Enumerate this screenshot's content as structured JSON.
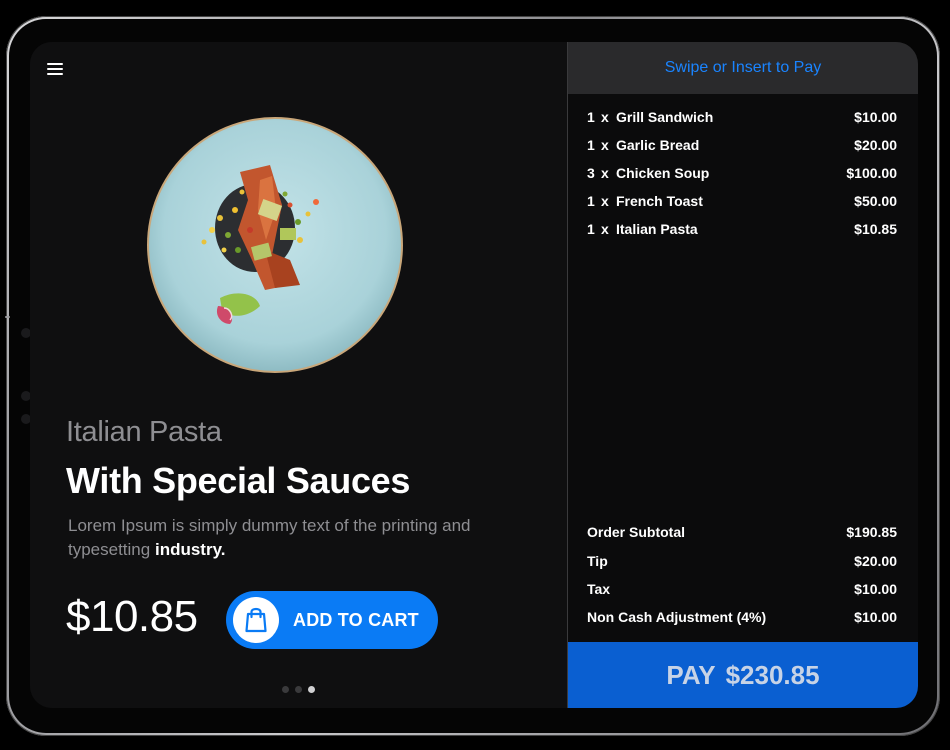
{
  "product": {
    "name": "Italian Pasta",
    "tagline": "With Special Sauces",
    "description": "Lorem Ipsum is simply dummy text of the printing and typesetting",
    "description_emphasis": "industry.",
    "price": "$10.85",
    "add_to_cart_label": "ADD TO CART",
    "image": "plated-dish-image",
    "carousel": {
      "count": 3,
      "active_index": 2
    }
  },
  "order_panel": {
    "header": "Swipe or Insert to Pay",
    "items": [
      {
        "qty": "1",
        "x": "x",
        "name": "Grill Sandwich",
        "amount": "$10.00"
      },
      {
        "qty": "1",
        "x": "x",
        "name": "Garlic Bread",
        "amount": "$20.00"
      },
      {
        "qty": "3",
        "x": "x",
        "name": "Chicken Soup",
        "amount": "$100.00"
      },
      {
        "qty": "1",
        "x": "x",
        "name": "French Toast",
        "amount": "$50.00"
      },
      {
        "qty": "1",
        "x": "x",
        "name": "Italian Pasta",
        "amount": "$10.85"
      }
    ],
    "summary": [
      {
        "label": "Order Subtotal",
        "amount": "$190.85"
      },
      {
        "label": "Tip",
        "amount": "$20.00"
      },
      {
        "label": "Tax",
        "amount": "$10.00"
      },
      {
        "label": "Non Cash Adjustment (4%)",
        "amount": "$10.00"
      }
    ],
    "pay_label": "PAY",
    "pay_amount": "$230.85"
  },
  "colors": {
    "accent": "#0a7bf5",
    "pay_button": "#0a5fd1",
    "header_text": "#1a84ff",
    "background": "#0f0f10"
  },
  "icons": [
    "menu-icon",
    "shopping-bag-icon"
  ]
}
